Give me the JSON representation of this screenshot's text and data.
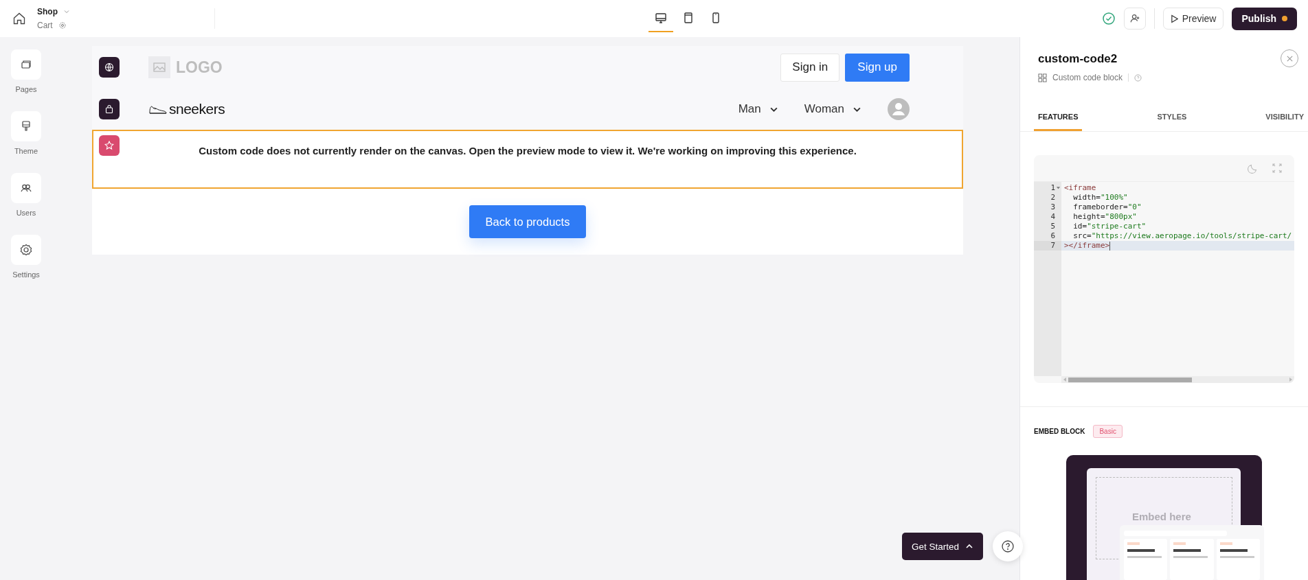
{
  "topbar": {
    "project": "Shop",
    "page": "Cart",
    "devices": [
      {
        "kind": "desktop",
        "selected": true
      },
      {
        "kind": "tablet",
        "selected": false
      },
      {
        "kind": "phone",
        "selected": false
      }
    ],
    "preview": "Preview",
    "publish": "Publish",
    "unpublished": true
  },
  "sidebar": {
    "items": [
      {
        "kind": "pages",
        "label": "Pages"
      },
      {
        "kind": "theme",
        "label": "Theme"
      },
      {
        "kind": "users",
        "label": "Users"
      },
      {
        "kind": "settings",
        "label": "Settings"
      }
    ]
  },
  "canvas": {
    "logo": "LOGO",
    "sign_in": "Sign in",
    "sign_up": "Sign up",
    "brand": "sneekers",
    "nav": [
      "Man",
      "Woman"
    ],
    "notice": "Custom code does not currently render on the canvas. Open the preview mode to view it. We're working on improving this experience.",
    "back_button": "Back to products"
  },
  "get_started": "Get Started",
  "panel": {
    "title": "custom-code2",
    "subtitle": "Custom code block",
    "tabs": [
      {
        "label": "FEATURES",
        "selected": true
      },
      {
        "label": "STYLES",
        "selected": false
      },
      {
        "label": "VISIBILITY",
        "selected": false
      }
    ],
    "code_lines": [
      {
        "number": "1",
        "active": false,
        "parts": [
          {
            "kind": "tag",
            "text": "<iframe"
          }
        ]
      },
      {
        "number": "2",
        "active": false,
        "parts": [
          {
            "kind": "attr",
            "text": "  width="
          },
          {
            "kind": "value",
            "text": "\"100%\""
          }
        ]
      },
      {
        "number": "3",
        "active": false,
        "parts": [
          {
            "kind": "attr",
            "text": "  frameborder="
          },
          {
            "kind": "value",
            "text": "\"0\""
          }
        ]
      },
      {
        "number": "4",
        "active": false,
        "parts": [
          {
            "kind": "attr",
            "text": "  height="
          },
          {
            "kind": "value",
            "text": "\"800px\""
          }
        ]
      },
      {
        "number": "5",
        "active": false,
        "parts": [
          {
            "kind": "attr",
            "text": "  id="
          },
          {
            "kind": "value",
            "text": "\"stripe-cart\""
          }
        ]
      },
      {
        "number": "6",
        "active": false,
        "parts": [
          {
            "kind": "attr",
            "text": "  src="
          },
          {
            "kind": "value",
            "text": "\"https://view.aeropage.io/tools/stripe-cart/"
          }
        ]
      },
      {
        "number": "7",
        "active": true,
        "parts": [
          {
            "kind": "tag",
            "text": "></iframe>"
          }
        ]
      }
    ],
    "embed_label": "EMBED BLOCK",
    "embed_badge": "Basic",
    "embed_preview_text": "Embed here"
  }
}
